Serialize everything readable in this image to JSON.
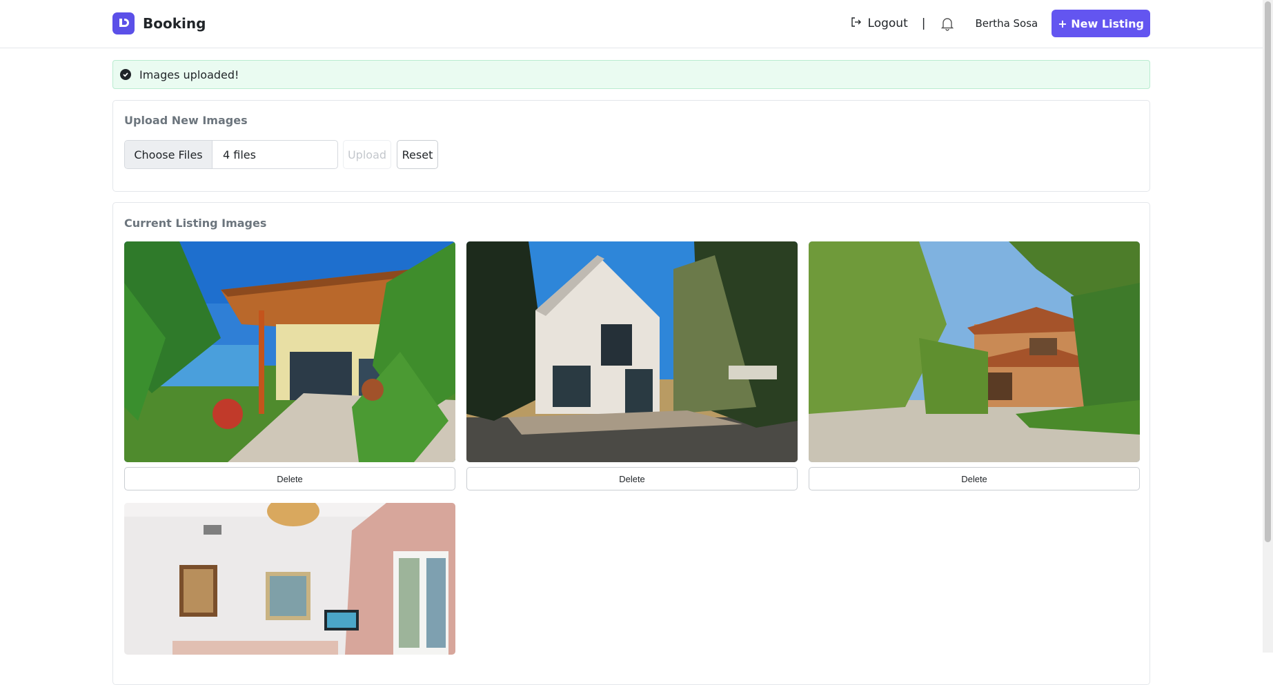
{
  "nav": {
    "brand": "Booking",
    "logout_label": "Logout",
    "separator": "|",
    "user_name": "Bertha Sosa",
    "new_listing_label": "+ New Listing"
  },
  "alert": {
    "message": "Images uploaded!",
    "color": "#eafbf1"
  },
  "upload": {
    "title": "Upload New Images",
    "choose_label": "Choose Files",
    "file_count": "4 files",
    "upload_label": "Upload",
    "reset_label": "Reset"
  },
  "gallery": {
    "title": "Current Listing Images",
    "images": [
      {
        "scene": "tropical-villa-palms",
        "delete_label": "Delete"
      },
      {
        "scene": "white-cabin-pine-trees",
        "delete_label": "Delete"
      },
      {
        "scene": "terracotta-house-garden",
        "delete_label": "Delete"
      },
      {
        "scene": "pink-living-room",
        "delete_label": null
      }
    ]
  },
  "colors": {
    "accent": "#6355f0",
    "success_bg": "#eafbf1"
  }
}
